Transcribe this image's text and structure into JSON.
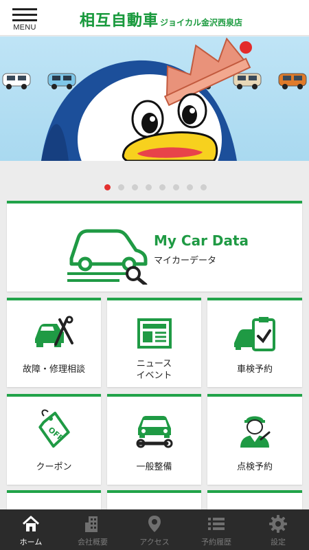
{
  "header": {
    "menu_label": "MENU",
    "logo_main": "相互自動車",
    "logo_sub": "ジョイカル金沢西泉店"
  },
  "banner": {
    "slide_count": 8,
    "active_slide": 1
  },
  "my_car_data": {
    "title": "My Car Data",
    "subtitle": "マイカーデータ"
  },
  "tiles": [
    {
      "label": "故障・修理相談",
      "icon": "car-repair-icon"
    },
    {
      "label": "ニュース\nイベント",
      "icon": "newspaper-icon"
    },
    {
      "label": "車検予約",
      "icon": "inspection-clipboard-icon"
    },
    {
      "label": "クーポン",
      "icon": "coupon-tag-icon"
    },
    {
      "label": "一般整備",
      "icon": "car-wrench-icon"
    },
    {
      "label": "点検予約",
      "icon": "mechanic-icon"
    }
  ],
  "tabbar": {
    "items": [
      {
        "label": "ホーム",
        "icon": "home-icon",
        "active": true
      },
      {
        "label": "会社概要",
        "icon": "building-icon",
        "active": false
      },
      {
        "label": "アクセス",
        "icon": "map-pin-icon",
        "active": false
      },
      {
        "label": "予約履歴",
        "icon": "list-icon",
        "active": false
      },
      {
        "label": "設定",
        "icon": "gear-icon",
        "active": false
      }
    ]
  },
  "colors": {
    "brand_green": "#21a349",
    "active_dot": "#e3302f",
    "tabbar_bg": "#2b2b2b"
  }
}
